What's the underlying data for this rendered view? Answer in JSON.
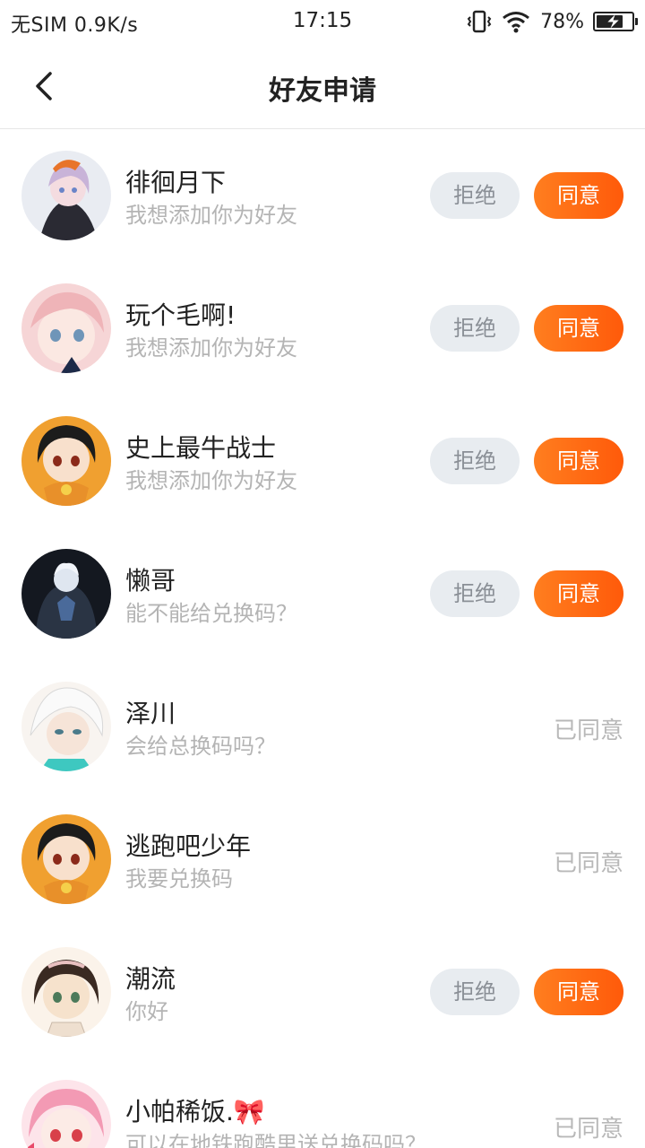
{
  "status_bar": {
    "carrier_speed": "无SIM 0.9K/s",
    "time": "17:15",
    "battery_pct": "78%",
    "battery_level": 0.78,
    "icons": [
      "vibrate-icon",
      "wifi-icon",
      "battery-charging-icon"
    ]
  },
  "header": {
    "title": "好友申请",
    "back_icon": "chevron-left-icon"
  },
  "buttons": {
    "reject_label": "拒绝",
    "agree_label": "同意",
    "agreed_label": "已同意"
  },
  "colors": {
    "accent": "#ff6a12",
    "reject_bg": "#e8ecf0",
    "subtext": "#b4b4b4"
  },
  "requests": [
    {
      "name": "徘徊月下",
      "message": "我想添加你为好友",
      "status": "pending"
    },
    {
      "name": "玩个毛啊!",
      "message": "我想添加你为好友",
      "status": "pending"
    },
    {
      "name": "史上最牛战士",
      "message": "我想添加你为好友",
      "status": "pending"
    },
    {
      "name": "懒哥",
      "message": "能不能给兑换码？",
      "status": "pending"
    },
    {
      "name": "泽川",
      "message": "会给总换码吗？",
      "status": "agreed"
    },
    {
      "name": "逃跑吧少年",
      "message": "我要兑换码",
      "status": "agreed"
    },
    {
      "name": "潮流",
      "message": "你好",
      "status": "pending"
    },
    {
      "name": "小帕稀饭.🎀",
      "message": "可以在地铁跑酷里送兑换码吗？",
      "status": "agreed"
    }
  ]
}
